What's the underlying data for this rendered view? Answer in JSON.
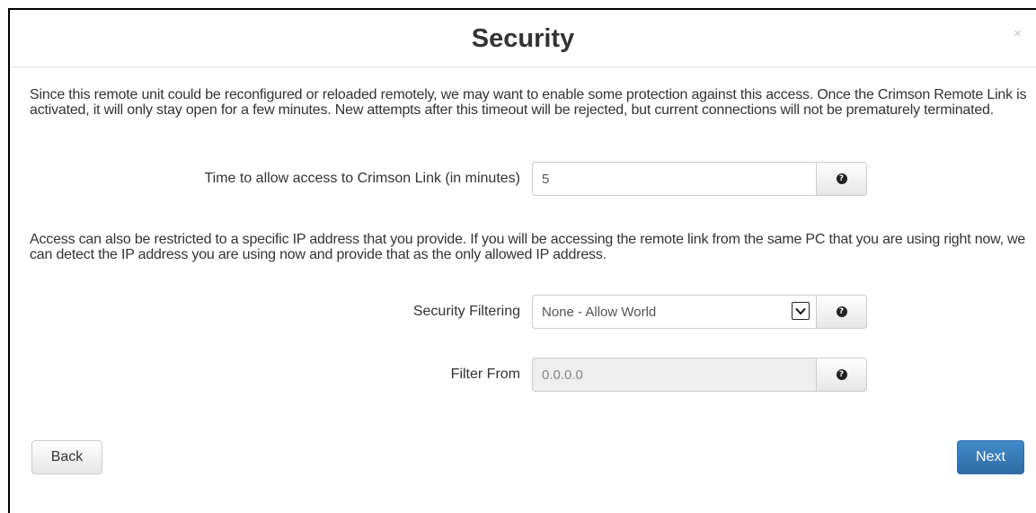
{
  "dialog": {
    "title": "Security",
    "close_label": "×"
  },
  "intro": {
    "text": "Since this remote unit could be reconfigured or reloaded remotely, we may want to enable some protection against this access. Once the Crimson Remote Link is activated, it will only stay open for a few minutes. New attempts after this timeout will be rejected, but current connections will not be prematurely terminated."
  },
  "time_access": {
    "label": "Time to allow access to Crimson Link (in minutes)",
    "value": "5",
    "help_icon": "question-circle-icon"
  },
  "ip_restriction": {
    "text": "Access can also be restricted to a specific IP address that you provide. If you will be accessing the remote link from the same PC that you are using right now, we can detect the IP address you are using now and provide that as the only allowed IP address."
  },
  "security_filtering": {
    "label": "Security Filtering",
    "selected": "None - Allow World",
    "help_icon": "question-circle-icon"
  },
  "filter_from": {
    "label": "Filter From",
    "value": "0.0.0.0",
    "help_icon": "question-circle-icon"
  },
  "footer": {
    "back_label": "Back",
    "next_label": "Next",
    "next_color": "#428bca"
  }
}
